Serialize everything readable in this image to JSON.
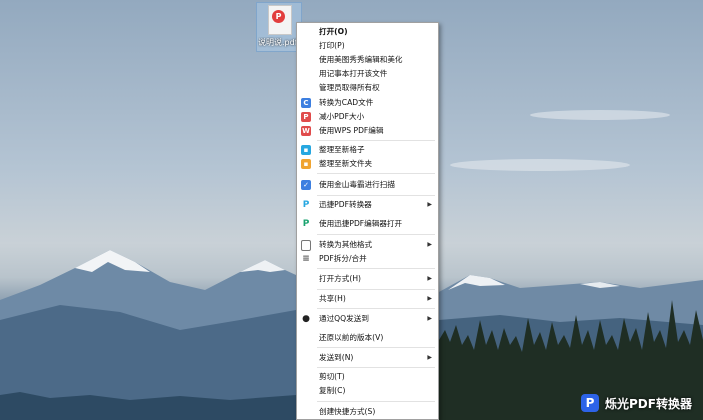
{
  "desktop": {
    "file": {
      "name": "说明说.pdf",
      "badge": "P"
    }
  },
  "context_menu": {
    "open": "打开(O)",
    "print": "打印(P)",
    "meitu": "使用美图秀秀编辑和美化",
    "notepad": "用记事本打开该文件",
    "ownership": "管理员取得所有权",
    "to_cad": "转换为CAD文件",
    "shrink_pdf": "减小PDF大小",
    "wps_edit": "使用WPS PDF编辑",
    "new_grid": "整理至新格子",
    "new_folder": "整理至新文件夹",
    "kingsoft_scan": "使用金山毒霸进行扫描",
    "xunjie_converter": "迅捷PDF转换器",
    "xunjie_editor": "使用迅捷PDF编辑器打开",
    "convert_other": "转换为其他格式",
    "split_merge": "PDF拆分/合并",
    "open_with": "打开方式(H)",
    "share": "共享(H)",
    "qq_send": "通过QQ发送到",
    "restore": "还原以前的版本(V)",
    "send_to": "发送到(N)",
    "cut": "剪切(T)",
    "copy": "复制(C)",
    "create_shortcut": "创建快捷方式(S)"
  },
  "watermark": {
    "mark": "P",
    "text": "烁光PDF转换器"
  },
  "colors": {
    "blue": "#3d7fe0",
    "red": "#e04b4b",
    "orange": "#f0a431",
    "cyan": "#27a7e0",
    "green": "#1aa36f"
  }
}
